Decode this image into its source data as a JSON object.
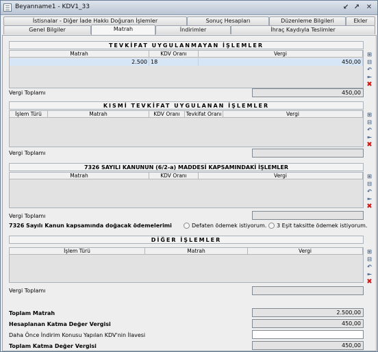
{
  "window": {
    "title": "Beyanname1 - KDV1_33",
    "buttons": [
      "minimize-icon",
      "restore-icon",
      "close-icon"
    ]
  },
  "tabs": {
    "row1": [
      "İstisnalar - Diğer İade Hakkı Doğuran İşlemler",
      "Sonuç Hesapları",
      "Düzenleme Bilgileri",
      "Ekler"
    ],
    "row2": [
      "Genel Bilgiler",
      "Matrah",
      "İndirimler",
      "İhraç Kaydıyla Teslimler"
    ],
    "active": "Matrah"
  },
  "section1": {
    "title": "TEVKİFAT UYGULANMAYAN İŞLEMLER",
    "columns": [
      "Matrah",
      "KDV Oranı",
      "Vergi"
    ],
    "rows": [
      {
        "matrah": "2.500",
        "kdv_orani": "18",
        "vergi": "450,00"
      }
    ],
    "total_label": "Vergi Toplamı",
    "total_value": "450,00"
  },
  "section2": {
    "title": "KISMİ TEVKİFAT UYGULANAN İŞLEMLER",
    "columns": [
      "İşlem Türü",
      "Matrah",
      "KDV Oranı",
      "Tevkifat Oranı",
      "Vergi"
    ],
    "total_label": "Vergi Toplamı",
    "total_value": ""
  },
  "section3": {
    "title": "7326 SAYILI KANUNUN (6/2-a) MADDESİ KAPSAMINDAKİ İŞLEMLER",
    "columns": [
      "Matrah",
      "KDV Oranı",
      "Vergi"
    ],
    "total_label": "Vergi Toplamı",
    "total_value": ""
  },
  "payment": {
    "label": "7326 Sayılı Kanun kapsamında doğacak ödemelerimi",
    "option1": "Defaten ödemek istiyorum.",
    "option2": "3 Eşit taksitte ödemek istiyorum."
  },
  "section4": {
    "title": "DİĞER İŞLEMLER",
    "columns": [
      "İşlem Türü",
      "Matrah",
      "Vergi"
    ],
    "total_label": "Vergi Toplamı",
    "total_value": ""
  },
  "summary": {
    "toplam_matrah_label": "Toplam Matrah",
    "toplam_matrah_value": "2.500,00",
    "hesaplanan_label": "Hesaplanan Katma Değer Vergisi",
    "hesaplanan_value": "450,00",
    "ilave_label": "Daha Önce İndirim Konusu Yapılan KDV'nin İlavesi",
    "ilave_value": "",
    "toplam_kdv_label": "Toplam Katma Değer Vergisi",
    "toplam_kdv_value": "450,00"
  },
  "grid_buttons": [
    "add-row-icon",
    "remove-row-icon",
    "undo-icon",
    "import-icon",
    "delete-icon"
  ]
}
